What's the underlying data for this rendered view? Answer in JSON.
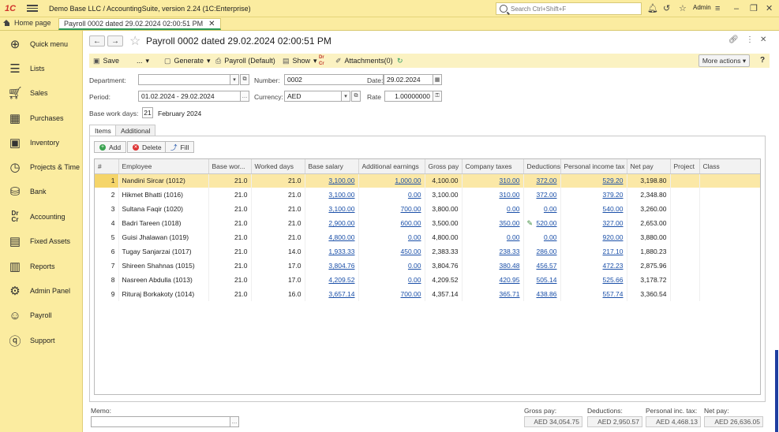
{
  "app": {
    "logo": "1С",
    "title": "Demo Base LLC / AccountingSuite, version 2.24  (1C:Enterprise)",
    "search_placeholder": "Search Ctrl+Shift+F",
    "user": "Admin"
  },
  "tabs": {
    "home": "Home page",
    "document": "Payroll 0002 dated 29.02.2024 02:00:51 PM"
  },
  "sidebar": {
    "items": [
      {
        "label": "Quick menu",
        "icon": "quick-menu-icon"
      },
      {
        "label": "Lists",
        "icon": "lists-icon"
      },
      {
        "label": "Sales",
        "icon": "basket-icon"
      },
      {
        "label": "Purchases",
        "icon": "purchases-icon"
      },
      {
        "label": "Inventory",
        "icon": "forklift-icon"
      },
      {
        "label": "Projects & Time",
        "icon": "clock-icon"
      },
      {
        "label": "Bank",
        "icon": "coins-icon"
      },
      {
        "label": "Accounting",
        "icon": "dr-cr-icon"
      },
      {
        "label": "Fixed Assets",
        "icon": "fixed-assets-icon"
      },
      {
        "label": "Reports",
        "icon": "reports-icon"
      },
      {
        "label": "Admin Panel",
        "icon": "gear-icon"
      },
      {
        "label": "Payroll",
        "icon": "person-icon"
      },
      {
        "label": "Support",
        "icon": "question-icon"
      }
    ]
  },
  "document": {
    "title": "Payroll 0002 dated 29.02.2024 02:00:51 PM"
  },
  "toolbar": {
    "save": "Save",
    "dots": "...",
    "generate": "Generate",
    "payroll_default": "Payroll (Default)",
    "show": "Show",
    "attachments": "Attachments(0)",
    "more_actions": "More actions",
    "help": "?"
  },
  "form": {
    "department_label": "Department:",
    "department_value": "",
    "number_label": "Number:",
    "number_value": "0002",
    "date_label": "Date:",
    "date_value": "29.02.2024",
    "period_label": "Period:",
    "period_value": "01.02.2024 - 29.02.2024",
    "currency_label": "Currency:",
    "currency_value": "AED",
    "rate_label": "Rate",
    "rate_value": "1.00000000",
    "base_work_days_label": "Base work days:",
    "base_work_days_value": "21",
    "month_label": "February 2024"
  },
  "form_tabs": [
    "Items",
    "Additional"
  ],
  "items_toolbar": {
    "add": "Add",
    "delete": "Delete",
    "fill": "Fill"
  },
  "table": {
    "columns": [
      "#",
      "Employee",
      "Base wor...",
      "Worked days",
      "Base salary",
      "Additional earnings",
      "Gross pay",
      "Company taxes",
      "Deductions",
      "Personal income tax",
      "Net pay",
      "Project",
      "Class"
    ],
    "rows": [
      {
        "n": "1",
        "employee": "Nandini Sircar (1012)",
        "base": "21.0",
        "worked": "21.0",
        "salary": "3,100.00",
        "additional": "1,000.00",
        "gross": "4,100.00",
        "company_taxes": "310.00",
        "deductions": "372.00",
        "pit": "529.20",
        "net": "3,198.80"
      },
      {
        "n": "2",
        "employee": "Hikmet Bhatti (1016)",
        "base": "21.0",
        "worked": "21.0",
        "salary": "3,100.00",
        "additional": "0.00",
        "gross": "3,100.00",
        "company_taxes": "310.00",
        "deductions": "372.00",
        "pit": "379.20",
        "net": "2,348.80"
      },
      {
        "n": "3",
        "employee": "Sultana Faqir (1020)",
        "base": "21.0",
        "worked": "21.0",
        "salary": "3,100.00",
        "additional": "700.00",
        "gross": "3,800.00",
        "company_taxes": "0.00",
        "deductions": "0.00",
        "pit": "540.00",
        "net": "3,260.00"
      },
      {
        "n": "4",
        "employee": "Badri Tareen (1018)",
        "base": "21.0",
        "worked": "21.0",
        "salary": "2,900.00",
        "additional": "600.00",
        "gross": "3,500.00",
        "company_taxes": "350.00",
        "deductions": "520.00",
        "pit": "327.00",
        "net": "2,653.00"
      },
      {
        "n": "5",
        "employee": "Guisi Jhalawan (1019)",
        "base": "21.0",
        "worked": "21.0",
        "salary": "4,800.00",
        "additional": "0.00",
        "gross": "4,800.00",
        "company_taxes": "0.00",
        "deductions": "0.00",
        "pit": "920.00",
        "net": "3,880.00"
      },
      {
        "n": "6",
        "employee": "Tugay Sanjarzai (1017)",
        "base": "21.0",
        "worked": "14.0",
        "salary": "1,933.33",
        "additional": "450.00",
        "gross": "2,383.33",
        "company_taxes": "238.33",
        "deductions": "286.00",
        "pit": "217.10",
        "net": "1,880.23"
      },
      {
        "n": "7",
        "employee": "Shireen Shahnas (1015)",
        "base": "21.0",
        "worked": "17.0",
        "salary": "3,804.76",
        "additional": "0.00",
        "gross": "3,804.76",
        "company_taxes": "380.48",
        "deductions": "456.57",
        "pit": "472.23",
        "net": "2,875.96"
      },
      {
        "n": "8",
        "employee": "Nasreen Abdulla (1013)",
        "base": "21.0",
        "worked": "17.0",
        "salary": "4,209.52",
        "additional": "0.00",
        "gross": "4,209.52",
        "company_taxes": "420.95",
        "deductions": "505.14",
        "pit": "525.66",
        "net": "3,178.72"
      },
      {
        "n": "9",
        "employee": "Rituraj Borkakoty (1014)",
        "base": "21.0",
        "worked": "16.0",
        "salary": "3,657.14",
        "additional": "700.00",
        "gross": "4,357.14",
        "company_taxes": "365.71",
        "deductions": "438.86",
        "pit": "557.74",
        "net": "3,360.54"
      }
    ]
  },
  "footer": {
    "memo_label": "Memo:",
    "memo_value": "",
    "gross_label": "Gross pay:",
    "gross_value": "AED 34,054.75",
    "deductions_label": "Deductions:",
    "deductions_value": "AED 2,950.57",
    "pit_label": "Personal inc. tax:",
    "pit_value": "AED 4,468.13",
    "net_label": "Net pay:",
    "net_value": "AED 26,636.05"
  },
  "colors": {
    "accent_panel": "#fbeca0",
    "link": "#1a4fa8",
    "selected_row": "#fbe8a6",
    "active_tab_underline": "#2a9a5a"
  }
}
